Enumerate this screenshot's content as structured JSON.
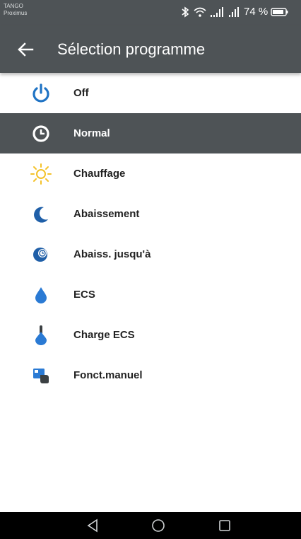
{
  "status_bar": {
    "carrier_line1": "TANGO",
    "carrier_line2": "Proximus",
    "battery_text": "74 %"
  },
  "app_bar": {
    "title": "Sélection programme"
  },
  "programs": [
    {
      "label": "Off",
      "icon": "power-icon",
      "selected": false
    },
    {
      "label": "Normal",
      "icon": "clock-icon",
      "selected": true
    },
    {
      "label": "Chauffage",
      "icon": "sun-icon",
      "selected": false
    },
    {
      "label": "Abaissement",
      "icon": "moon-icon",
      "selected": false
    },
    {
      "label": "Abaiss. jusqu'à",
      "icon": "moon-clock-icon",
      "selected": false
    },
    {
      "label": "ECS",
      "icon": "water-drop-icon",
      "selected": false
    },
    {
      "label": "Charge ECS",
      "icon": "thermometer-drop-icon",
      "selected": false
    },
    {
      "label": "Fonct.manuel",
      "icon": "manual-hand-icon",
      "selected": false
    }
  ],
  "colors": {
    "bar": "#4e5356",
    "accent_blue": "#1f73c4",
    "sun_yellow": "#f4c22a"
  }
}
